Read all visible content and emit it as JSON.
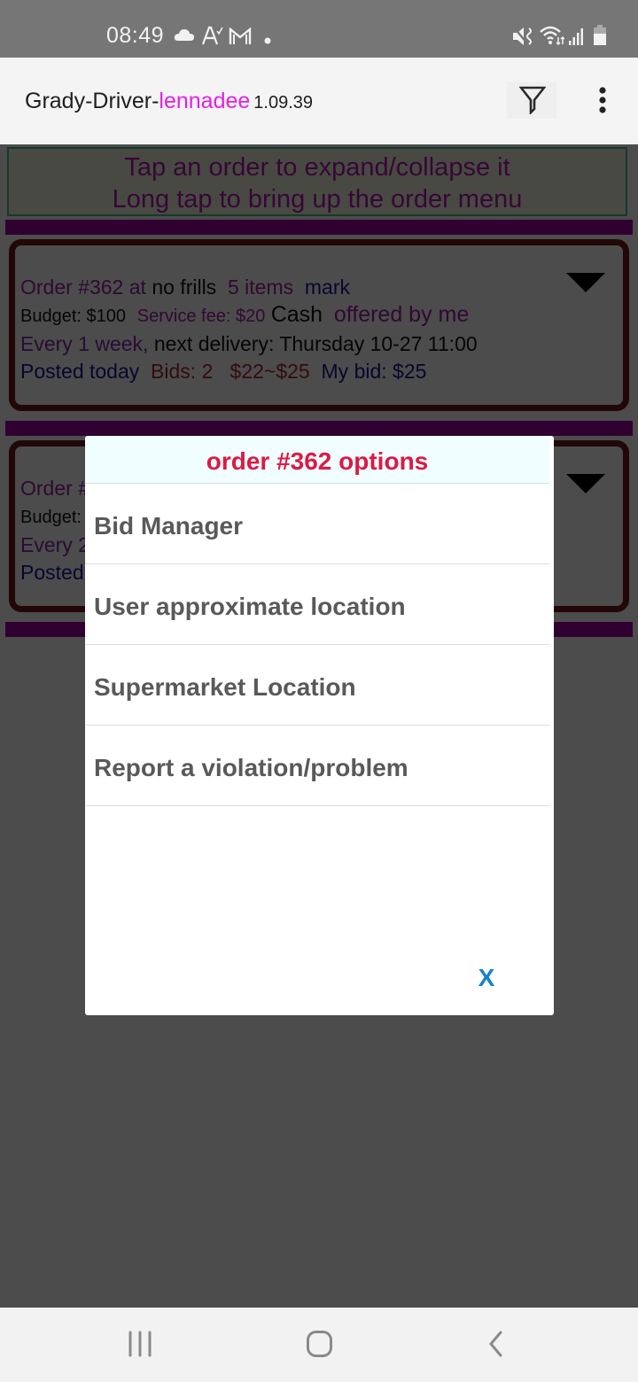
{
  "status_bar": {
    "time": "08:49",
    "left_icons": [
      "cloud-icon",
      "font-a-check-icon",
      "gmail-icon",
      "dot-icon"
    ],
    "right_icons": [
      "mute-vibrate-icon",
      "wifi-icon",
      "signal-icon",
      "battery-icon"
    ]
  },
  "app_bar": {
    "title_prefix": "Grady-Driver-",
    "username": "lennadee",
    "version": "1.09.39",
    "actions": [
      "filter-icon",
      "more-vert-icon"
    ]
  },
  "hint": {
    "line1": "Tap an order to expand/collapse it",
    "line2": "Long tap to bring up the order menu"
  },
  "orders": [
    {
      "order_label": "Order #362",
      "at_label": "at",
      "store": "no frills",
      "items": "5 items",
      "customer": "mark",
      "budget": "Budget: $100",
      "service_fee": "Service fee: $20",
      "payment": "Cash",
      "offered": "offered by me",
      "frequency": "Every 1 week,",
      "next_delivery": "next delivery: Thursday 10-27 11:00",
      "posted": "Posted today",
      "bids": "Bids: 2",
      "bid_range": "$22~$25",
      "my_bid": "My bid: $25"
    },
    {
      "order_label": "Order #",
      "budget": "Budget:",
      "frequency": "Every 2",
      "posted": "Posted"
    }
  ],
  "dialog": {
    "title": "order #362 options",
    "items": [
      "Bid Manager",
      "User approximate location",
      "Supermarket Location",
      "Report a violation/problem"
    ],
    "close_label": "X"
  },
  "nav_bar": {
    "buttons": [
      "recent-apps-icon",
      "home-icon",
      "back-icon"
    ]
  }
}
